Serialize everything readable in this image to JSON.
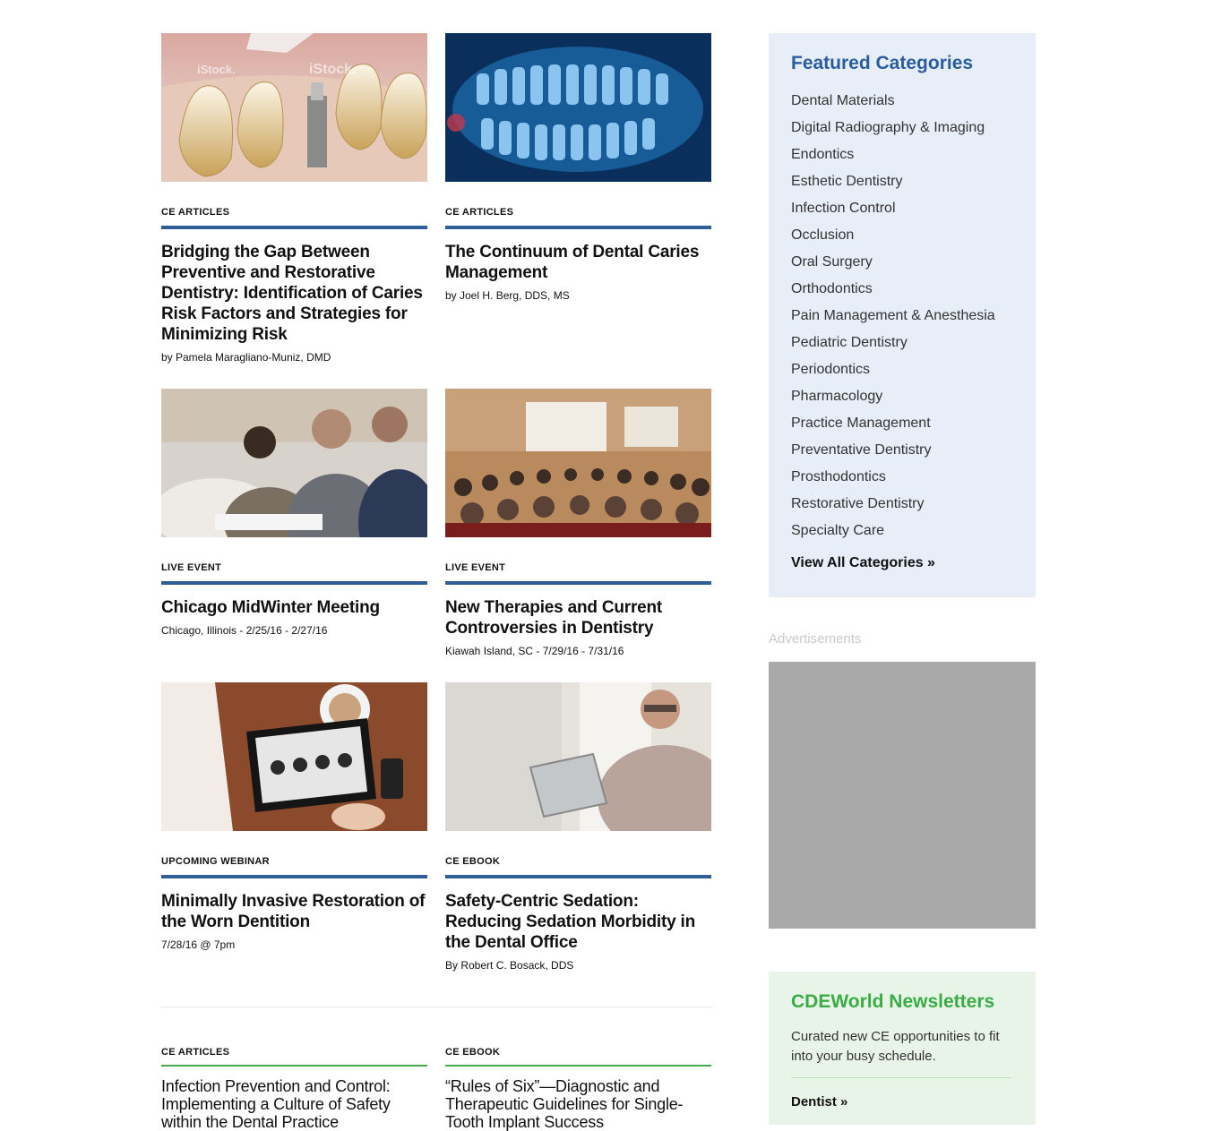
{
  "cards": [
    {
      "category": "CE ARTICLES",
      "title": "Bridging the Gap Between Preventive and Restorative Dentistry: Identification of Caries Risk Factors and Strategies for Minimizing Risk",
      "meta": "by Pamela Maragliano-Muniz, DMD"
    },
    {
      "category": "CE ARTICLES",
      "title": "The Continuum of Dental Caries Management",
      "meta": "by Joel H. Berg, DDS, MS"
    },
    {
      "category": "LIVE EVENT",
      "title": "Chicago MidWinter Meeting",
      "meta": "Chicago, Illinois - 2/25/16 - 2/27/16"
    },
    {
      "category": "LIVE EVENT",
      "title": "New Therapies and Current Controversies in Dentistry",
      "meta": "Kiawah Island, SC - 7/29/16 - 7/31/16"
    },
    {
      "category": "UPCOMING WEBINAR",
      "title": "Minimally Invasive Restoration of the Worn Dentition",
      "meta": "7/28/16 @ 7pm"
    },
    {
      "category": "CE EBOOK",
      "title": "Safety-Centric Sedation: Reducing Sedation Morbidity in the Dental Office",
      "meta": "By Robert C. Bosack, DDS"
    }
  ],
  "small_cards": [
    {
      "category": "CE ARTICLES",
      "title": "Infection Prevention and Control: Implementing a Culture of Safety within the Dental Practice"
    },
    {
      "category": "CE EBOOK",
      "title": "“Rules of Six”—Diagnostic and Therapeutic Guidelines for Single-Tooth Implant Success"
    }
  ],
  "watermark": "iStock.",
  "sidebar": {
    "heading": "Featured Categories",
    "categories": [
      "Dental Materials",
      "Digital Radiography & Imaging",
      "Endontics",
      "Esthetic Dentistry",
      "Infection Control",
      "Occlusion",
      "Oral Surgery",
      "Orthodontics",
      "Pain Management & Anesthesia",
      "Pediatric Dentistry",
      "Periodontics",
      "Pharmacology",
      "Practice Management",
      "Preventative Dentistry",
      "Prosthodontics",
      "Restorative Dentistry",
      "Specialty Care"
    ],
    "view_all": "View All Categories »"
  },
  "ads": {
    "label": "Advertisements"
  },
  "newsletter": {
    "heading": "CDEWorld Newsletters",
    "description": "Curated new CE opportunities to fit into your busy schedule.",
    "link": "Dentist »"
  },
  "colors": {
    "accent_blue": "#2f5d95",
    "heading_blue": "#2a5d9f",
    "green": "#3aac45"
  }
}
